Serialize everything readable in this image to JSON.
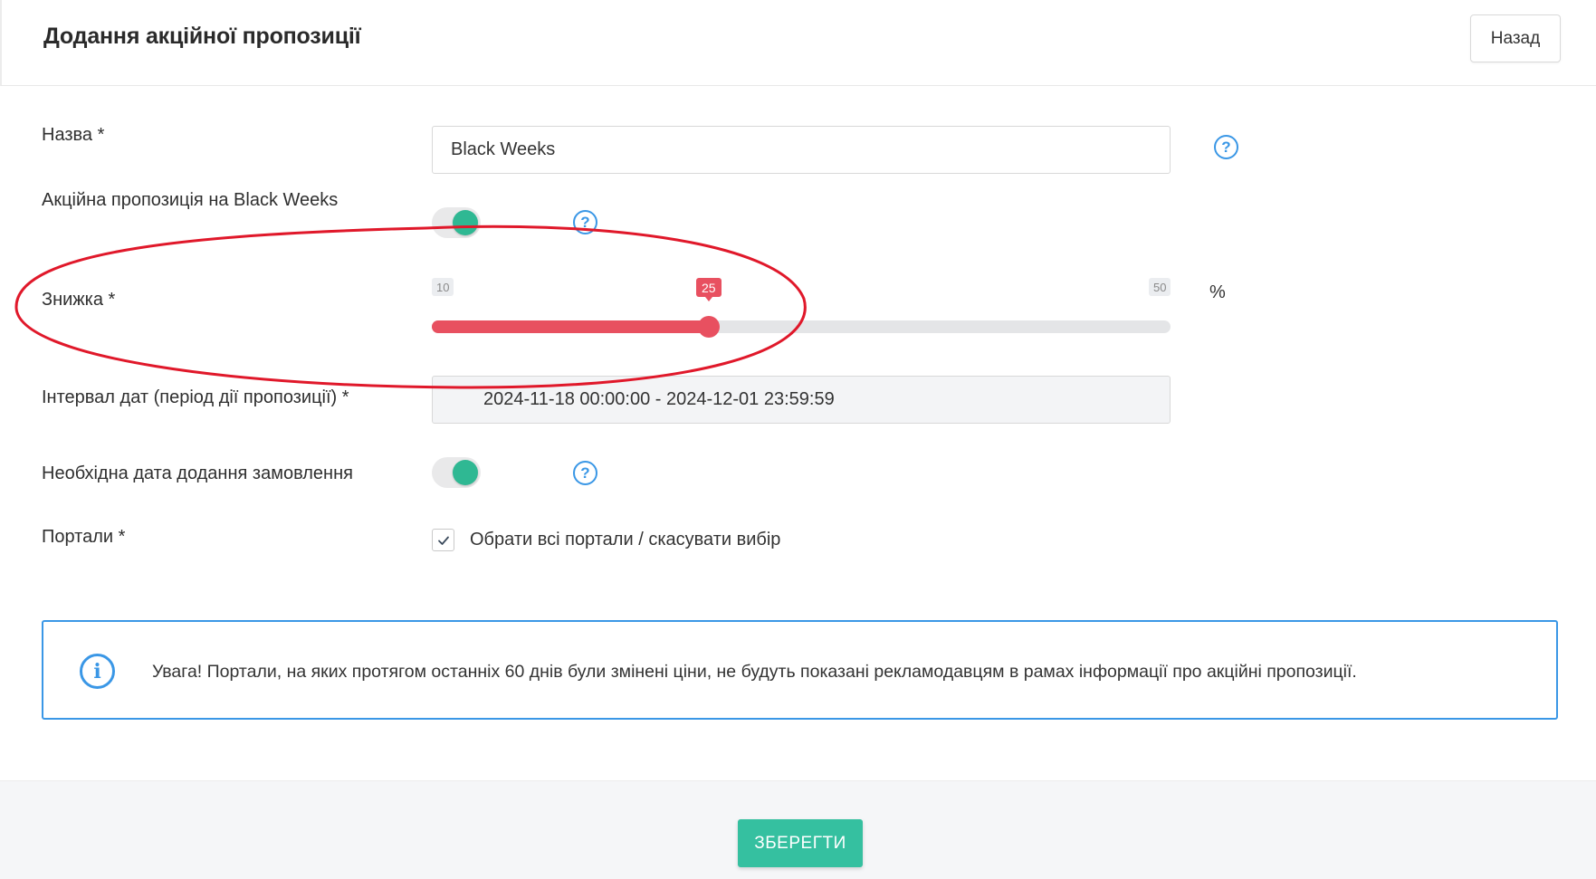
{
  "header": {
    "title": "Додання акційної пропозиції",
    "back_label": "Назад"
  },
  "form": {
    "name": {
      "label": "Назва *",
      "value": "Black Weeks"
    },
    "black_weeks": {
      "label": "Акційна пропозиція на Black Weeks",
      "enabled": true
    },
    "discount": {
      "label": "Знижка *",
      "min": "10",
      "max": "50",
      "value": "25",
      "unit": "%"
    },
    "date_range": {
      "label": "Інтервал дат (період дії пропозиції) *",
      "value": "2024-11-18 00:00:00 - 2024-12-01 23:59:59"
    },
    "order_date_required": {
      "label": "Необхідна дата додання замовлення",
      "enabled": true
    },
    "portals": {
      "label": "Портали *",
      "select_all_label": "Обрати всі портали / скасувати вибір",
      "checked": true
    }
  },
  "alert": {
    "text": "Увага! Портали, на яких протягом останніх 60 днів були змінені ціни, не будуть показані рекламодавцям в рамах інформації про акційні пропозиції."
  },
  "footer": {
    "save_label": "ЗБЕРЕГТИ"
  },
  "colors": {
    "accent_red": "#e85060",
    "accent_green": "#2fb893",
    "info_blue": "#3a97e6",
    "annotation_red": "#e0182a"
  },
  "icons": {
    "help": "question-circle-icon",
    "info": "info-circle-icon",
    "check": "check-icon"
  }
}
